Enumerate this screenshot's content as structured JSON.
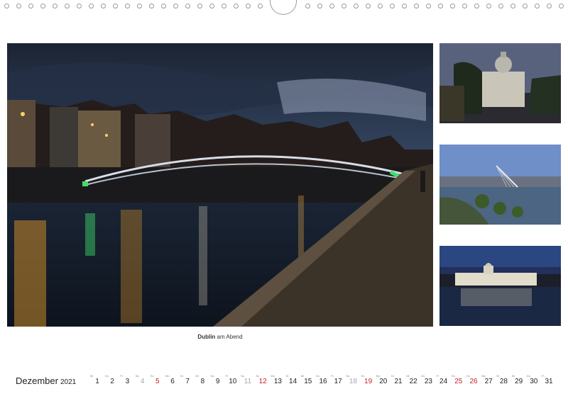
{
  "caption": {
    "bold": "Dublin",
    "rest": " am Abend"
  },
  "calendar": {
    "month": "Dezember",
    "year": "2021",
    "days": [
      {
        "num": "1",
        "wd": "Mi",
        "type": "w"
      },
      {
        "num": "2",
        "wd": "Do",
        "type": "w"
      },
      {
        "num": "3",
        "wd": "Fr",
        "type": "w"
      },
      {
        "num": "4",
        "wd": "Sa",
        "type": "sat"
      },
      {
        "num": "5",
        "wd": "So",
        "type": "sun"
      },
      {
        "num": "6",
        "wd": "Mo",
        "type": "w"
      },
      {
        "num": "7",
        "wd": "Di",
        "type": "w"
      },
      {
        "num": "8",
        "wd": "Mi",
        "type": "w"
      },
      {
        "num": "9",
        "wd": "Do",
        "type": "w"
      },
      {
        "num": "10",
        "wd": "Fr",
        "type": "w"
      },
      {
        "num": "11",
        "wd": "Sa",
        "type": "sat"
      },
      {
        "num": "12",
        "wd": "So",
        "type": "sun"
      },
      {
        "num": "13",
        "wd": "Mo",
        "type": "w"
      },
      {
        "num": "14",
        "wd": "Di",
        "type": "w"
      },
      {
        "num": "15",
        "wd": "Mi",
        "type": "w"
      },
      {
        "num": "16",
        "wd": "Do",
        "type": "w"
      },
      {
        "num": "17",
        "wd": "Fr",
        "type": "w"
      },
      {
        "num": "18",
        "wd": "Sa",
        "type": "sat"
      },
      {
        "num": "19",
        "wd": "So",
        "type": "sun"
      },
      {
        "num": "20",
        "wd": "Mo",
        "type": "w"
      },
      {
        "num": "21",
        "wd": "Di",
        "type": "w"
      },
      {
        "num": "22",
        "wd": "Mi",
        "type": "w"
      },
      {
        "num": "23",
        "wd": "Do",
        "type": "w"
      },
      {
        "num": "24",
        "wd": "Fr",
        "type": "w"
      },
      {
        "num": "25",
        "wd": "Sa",
        "type": "sun"
      },
      {
        "num": "26",
        "wd": "So",
        "type": "sun"
      },
      {
        "num": "27",
        "wd": "Mo",
        "type": "w"
      },
      {
        "num": "28",
        "wd": "Di",
        "type": "w"
      },
      {
        "num": "29",
        "wd": "Mi",
        "type": "w"
      },
      {
        "num": "30",
        "wd": "Do",
        "type": "w"
      },
      {
        "num": "31",
        "wd": "Fr",
        "type": "w"
      }
    ]
  },
  "colors": {
    "sunday": "#c8202a",
    "saturday": "#a8a8a8",
    "ring": "#9a9a9a"
  }
}
